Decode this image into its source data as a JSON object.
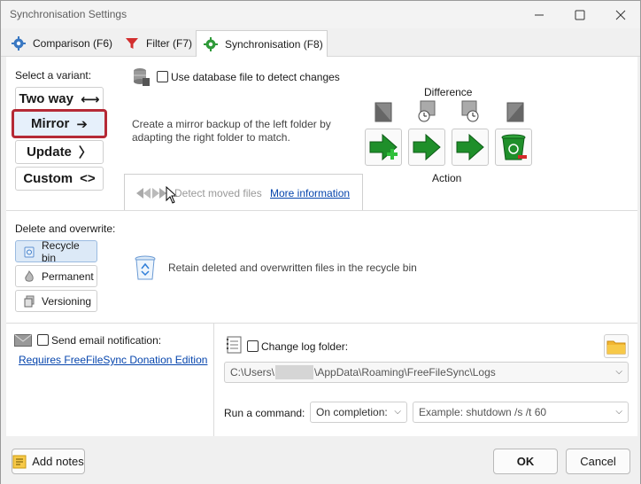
{
  "window": {
    "title": "Synchronisation Settings"
  },
  "tabs": [
    {
      "label": "Comparison (F6)",
      "icon": "gear-icon"
    },
    {
      "label": "Filter (F7)",
      "icon": "filter-icon"
    },
    {
      "label": "Synchronisation (F8)",
      "icon": "sync-gear-icon",
      "active": true
    }
  ],
  "variant": {
    "heading": "Select a variant:",
    "options": [
      {
        "label": "Two way",
        "arrow": "⟷"
      },
      {
        "label": "Mirror",
        "arrow": "➔",
        "selected": true
      },
      {
        "label": "Update",
        "arrow": "〉"
      },
      {
        "label": "Custom",
        "arrow": "<>"
      }
    ]
  },
  "database": {
    "label": "Use database file to detect changes",
    "checked": false
  },
  "description": "Create a mirror backup of the left folder by adapting the right folder to match.",
  "difference_label": "Difference",
  "action_label": "Action",
  "detect_moved": {
    "label": "Detect moved files",
    "more_info": "More information"
  },
  "delete": {
    "heading": "Delete and overwrite:",
    "options": [
      {
        "label": "Recycle bin",
        "selected": true
      },
      {
        "label": "Permanent"
      },
      {
        "label": "Versioning"
      }
    ],
    "description": "Retain deleted and overwritten files in the recycle bin"
  },
  "email": {
    "label": "Send email notification:",
    "checked": false,
    "link": "Requires FreeFileSync Donation Edition"
  },
  "log": {
    "label": "Change log folder:",
    "checked": false,
    "path_prefix": "C:\\Users\\",
    "path_suffix": "\\AppData\\Roaming\\FreeFileSync\\Logs"
  },
  "command": {
    "label": "Run a command:",
    "when": "On completion:",
    "placeholder": "Example: shutdown /s /t 60"
  },
  "footer": {
    "add_notes": "Add notes",
    "ok": "OK",
    "cancel": "Cancel"
  },
  "colors": {
    "accent_red": "#b52a36",
    "link": "#0645ad",
    "green": "#1f8f2a"
  }
}
